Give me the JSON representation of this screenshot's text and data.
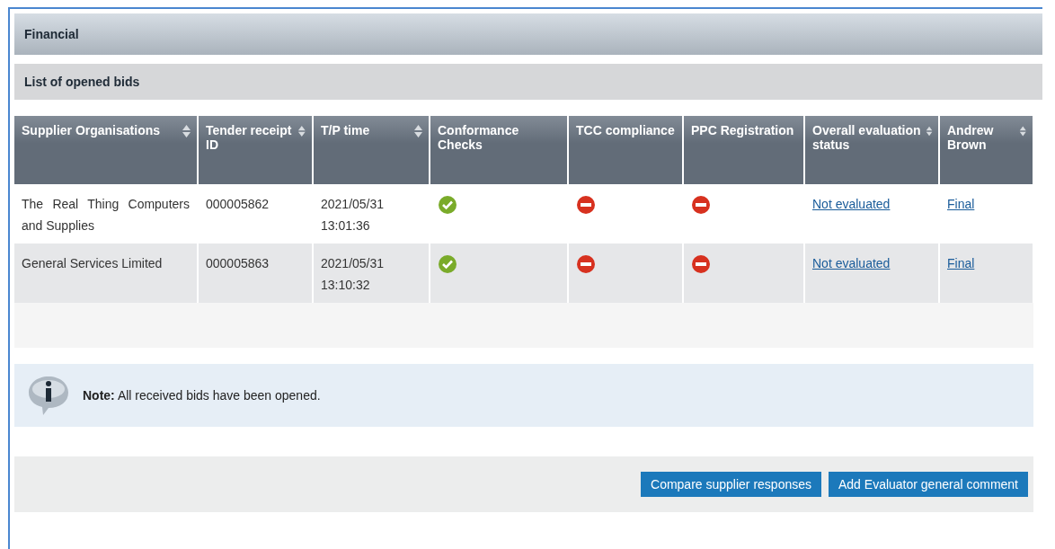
{
  "section_title": "Financial",
  "subsection_title": "List of opened bids",
  "table": {
    "columns": [
      {
        "label": "Supplier Organisations",
        "sortable": true
      },
      {
        "label": "Tender receipt ID",
        "sortable": true
      },
      {
        "label": "T/P time",
        "sortable": true
      },
      {
        "label": "Conformance Checks",
        "sortable": false
      },
      {
        "label": "TCC compliance",
        "sortable": false
      },
      {
        "label": "PPC Registration",
        "sortable": false
      },
      {
        "label": "Overall evaluation status",
        "sortable": true
      },
      {
        "label": "Andrew Brown",
        "sortable": true
      }
    ],
    "rows": [
      {
        "supplier": "The Real Thing Computers and Supplies",
        "receipt_id": "000005862",
        "tp_time": [
          "2021/05/31",
          "13:01:36"
        ],
        "conformance_ok": true,
        "tcc_ok": false,
        "ppc_ok": false,
        "overall_status": "Not evaluated",
        "evaluator": "Final"
      },
      {
        "supplier": "General Services Limited",
        "receipt_id": "000005863",
        "tp_time": [
          "2021/05/31",
          "13:10:32"
        ],
        "conformance_ok": true,
        "tcc_ok": false,
        "ppc_ok": false,
        "overall_status": "Not evaluated",
        "evaluator": "Final"
      }
    ]
  },
  "note": "**Note:** All received bids have been opened.",
  "buttons": [
    "Compare supplier responses",
    "Add Evaluator general comment"
  ]
}
